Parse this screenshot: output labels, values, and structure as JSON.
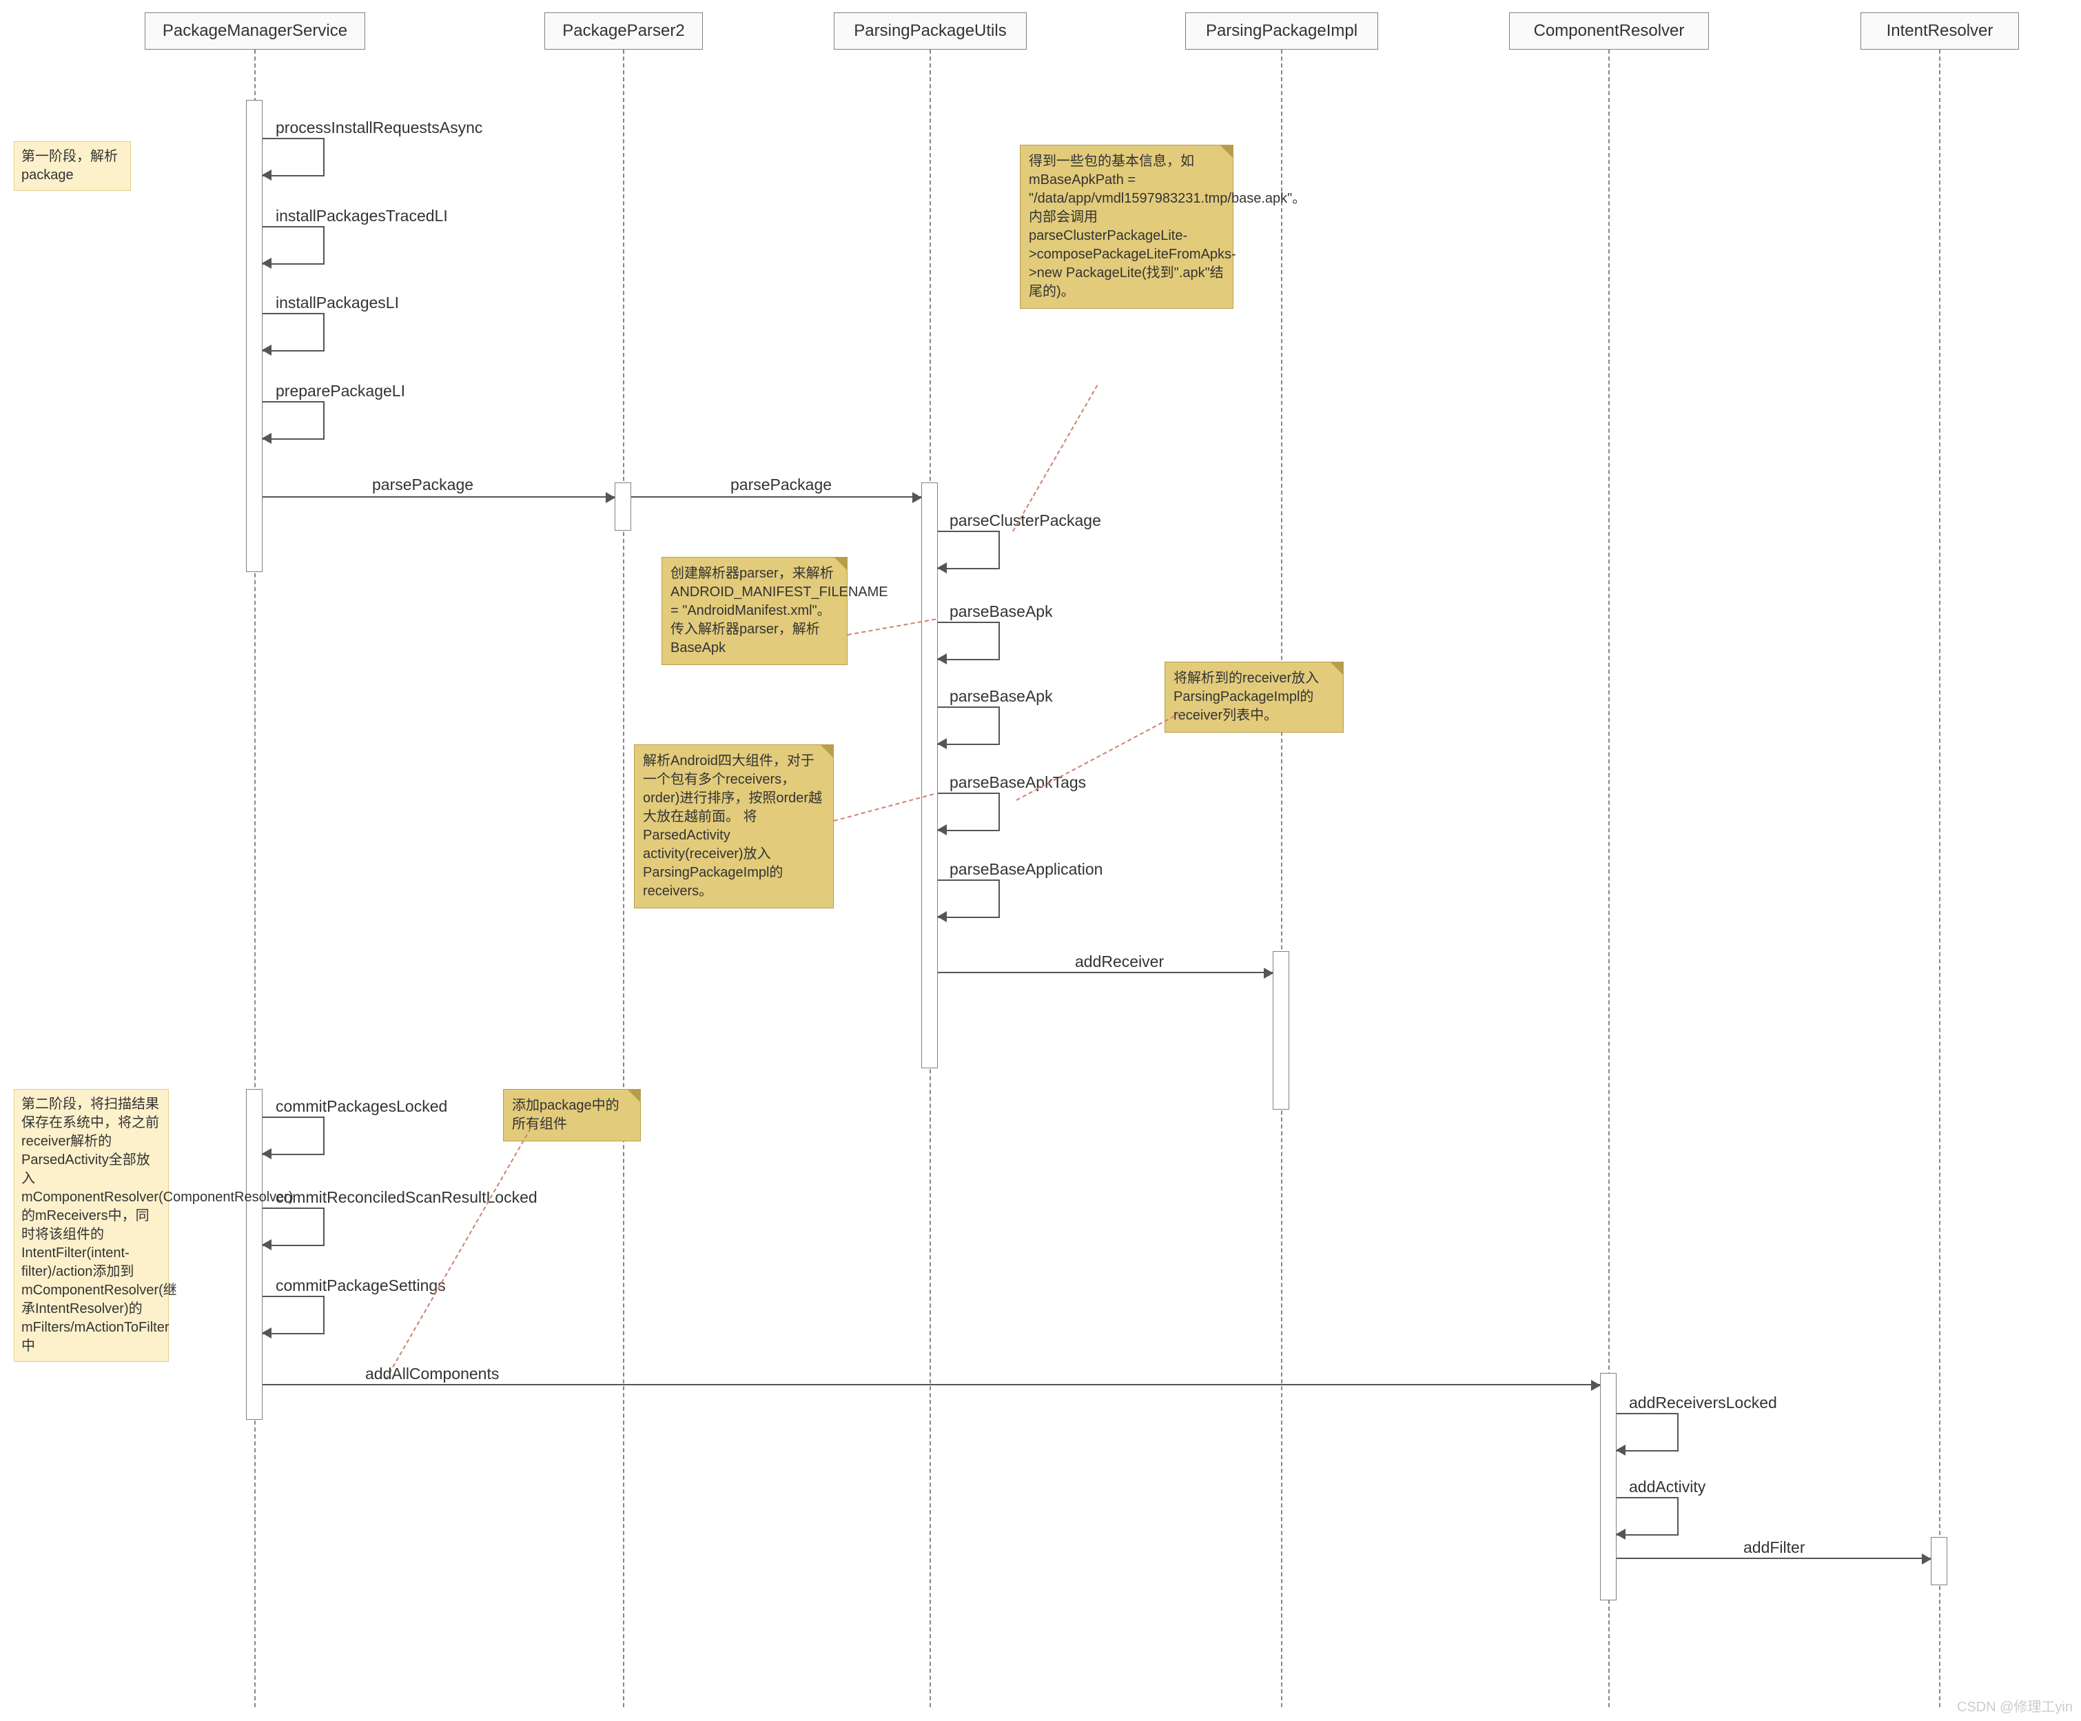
{
  "participants": {
    "p1": "PackageManagerService",
    "p2": "PackageParser2",
    "p3": "ParsingPackageUtils",
    "p4": "ParsingPackageImpl",
    "p5": "ComponentResolver",
    "p6": "IntentResolver"
  },
  "self_calls_pms": {
    "c1": "processInstallRequestsAsync",
    "c2": "installPackagesTracedLI",
    "c3": "installPackagesLI",
    "c4": "preparePackageLI"
  },
  "messages": {
    "m1": "parsePackage",
    "m2": "parsePackage"
  },
  "self_calls_ppu": {
    "c1": "parseClusterPackage",
    "c2": "parseBaseApk",
    "c3": "parseBaseApk",
    "c4": "parseBaseApkTags",
    "c5": "parseBaseApplication"
  },
  "message_addReceiver": "addReceiver",
  "self_calls_pms_phase2": {
    "c1": "commitPackagesLocked",
    "c2": "commitReconciledScanResultLocked",
    "c3": "commitPackageSettings"
  },
  "message_addAllComponents": "addAllComponents",
  "self_calls_component": {
    "c1": "addReceiversLocked",
    "c2": "addActivity"
  },
  "message_addFilter": "addFilter",
  "notes": {
    "n1": "第一阶段，解析package",
    "n2": "得到一些包的基本信息，如mBaseApkPath = \"/data/app/vmdl1597983231.tmp/base.apk\"。内部会调用parseClusterPackageLite->composePackageLiteFromApks->new PackageLite(找到\".apk\"结尾的)。",
    "n3": "创建解析器parser，来解析ANDROID_MANIFEST_FILENAME = \"AndroidManifest.xml\"。\n传入解析器parser，解析BaseApk",
    "n4": "将解析到的receiver放入ParsingPackageImpl的receiver列表中。",
    "n5": "解析Android四大组件，对于一个包有多个receivers，order)进行排序，按照order越大放在越前面。\n将ParsedActivity activity(receiver)放入ParsingPackageImpl的receivers。",
    "n6": "添加package中的所有组件",
    "n7": "第二阶段，将扫描结果保存在系统中，将之前receiver解析的ParsedActivity全部放入mComponentResolver(ComponentResolver)的mReceivers中，同时将该组件的IntentFilter(intent-filter)/action添加到mComponentResolver(继承IntentResolver)的mFilters/mActionToFilter中"
  },
  "watermark": "CSDN @修理工yin",
  "chart_data": {
    "type": "sequence-diagram",
    "participants": [
      "PackageManagerService",
      "PackageParser2",
      "ParsingPackageUtils",
      "ParsingPackageImpl",
      "ComponentResolver",
      "IntentResolver"
    ],
    "interactions": [
      {
        "from": "PackageManagerService",
        "to": "PackageManagerService",
        "label": "processInstallRequestsAsync",
        "type": "self"
      },
      {
        "from": "PackageManagerService",
        "to": "PackageManagerService",
        "label": "installPackagesTracedLI",
        "type": "self"
      },
      {
        "from": "PackageManagerService",
        "to": "PackageManagerService",
        "label": "installPackagesLI",
        "type": "self"
      },
      {
        "from": "PackageManagerService",
        "to": "PackageManagerService",
        "label": "preparePackageLI",
        "type": "self"
      },
      {
        "from": "PackageManagerService",
        "to": "PackageParser2",
        "label": "parsePackage",
        "type": "call"
      },
      {
        "from": "PackageParser2",
        "to": "ParsingPackageUtils",
        "label": "parsePackage",
        "type": "call"
      },
      {
        "from": "ParsingPackageUtils",
        "to": "ParsingPackageUtils",
        "label": "parseClusterPackage",
        "type": "self"
      },
      {
        "from": "ParsingPackageUtils",
        "to": "ParsingPackageUtils",
        "label": "parseBaseApk",
        "type": "self"
      },
      {
        "from": "ParsingPackageUtils",
        "to": "ParsingPackageUtils",
        "label": "parseBaseApk",
        "type": "self"
      },
      {
        "from": "ParsingPackageUtils",
        "to": "ParsingPackageUtils",
        "label": "parseBaseApkTags",
        "type": "self"
      },
      {
        "from": "ParsingPackageUtils",
        "to": "ParsingPackageUtils",
        "label": "parseBaseApplication",
        "type": "self"
      },
      {
        "from": "ParsingPackageUtils",
        "to": "ParsingPackageImpl",
        "label": "addReceiver",
        "type": "call"
      },
      {
        "from": "PackageManagerService",
        "to": "PackageManagerService",
        "label": "commitPackagesLocked",
        "type": "self"
      },
      {
        "from": "PackageManagerService",
        "to": "PackageManagerService",
        "label": "commitReconciledScanResultLocked",
        "type": "self"
      },
      {
        "from": "PackageManagerService",
        "to": "PackageManagerService",
        "label": "commitPackageSettings",
        "type": "self"
      },
      {
        "from": "PackageManagerService",
        "to": "ComponentResolver",
        "label": "addAllComponents",
        "type": "call"
      },
      {
        "from": "ComponentResolver",
        "to": "ComponentResolver",
        "label": "addReceiversLocked",
        "type": "self"
      },
      {
        "from": "ComponentResolver",
        "to": "ComponentResolver",
        "label": "addActivity",
        "type": "self"
      },
      {
        "from": "ComponentResolver",
        "to": "IntentResolver",
        "label": "addFilter",
        "type": "call"
      }
    ],
    "notes": [
      {
        "text": "第一阶段，解析package",
        "attached_to": "PackageManagerService",
        "position": "left"
      },
      {
        "text": "得到一些包的基本信息，如mBaseApkPath = \"/data/app/vmdl1597983231.tmp/base.apk\"。内部会调用parseClusterPackageLite->composePackageLiteFromApks->new PackageLite(找到\".apk\"结尾的)。",
        "attached_to": "parseClusterPackage"
      },
      {
        "text": "创建解析器parser，来解析ANDROID_MANIFEST_FILENAME = \"AndroidManifest.xml\"。传入解析器parser，解析BaseApk",
        "attached_to": "parseBaseApk"
      },
      {
        "text": "将解析到的receiver放入ParsingPackageImpl的receiver列表中。",
        "attached_to": "addReceiver"
      },
      {
        "text": "解析Android四大组件，对于一个包有多个receivers，order)进行排序，按照order越大放在越前面。将ParsedActivity activity(receiver)放入ParsingPackageImpl的receivers。",
        "attached_to": "parseBaseApkTags"
      },
      {
        "text": "添加package中的所有组件",
        "attached_to": "addAllComponents"
      },
      {
        "text": "第二阶段，将扫描结果保存在系统中，将之前receiver解析的ParsedActivity全部放入mComponentResolver(ComponentResolver)的mReceivers中，同时将该组件的IntentFilter(intent-filter)/action添加到mComponentResolver(继承IntentResolver)的mFilters/mActionToFilter中",
        "attached_to": "PackageManagerService",
        "position": "left"
      }
    ]
  }
}
